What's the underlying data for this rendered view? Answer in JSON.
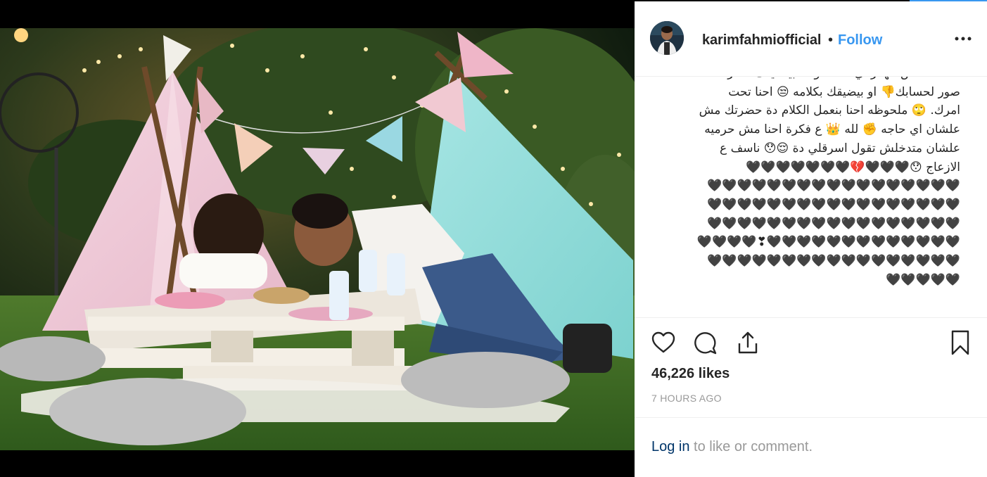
{
  "post": {
    "username": "karimfahmiofficial",
    "separator": "•",
    "follow_label": "Follow",
    "caption_lines": [
      "صفحه تخص الهكر اي.☠ اااكونت بيضايقك ناشر",
      "صور لحسابك👎 او بيضيقك بكلامه 😒 احنا تحت",
      "امرك. 🙄 ملحوظه احنا بنعمل الكلام دة حضرتك مش",
      "علشان اي حاجه ✊ لله 👑 ع فكرة احنا مش حرميه",
      "علشان متدخلش تقول اسرقلي دة 😌😯 ناسف ع",
      "الازعاج 😯🖤🖤🖤💔🖤🖤🖤🖤🖤🖤🖤",
      "🖤🖤🖤🖤🖤🖤🖤🖤🖤🖤🖤🖤🖤🖤🖤🖤🖤",
      "🖤🖤🖤🖤🖤🖤🖤🖤🖤🖤🖤🖤🖤🖤🖤🖤🖤",
      "🖤🖤🖤🖤🖤🖤🖤🖤🖤🖤🖤🖤🖤🖤🖤🖤🖤",
      "🖤🖤🖤🖤🖤🖤🖤🖤🖤🖤🖤🖤🖤❣🖤🖤🖤🖤",
      "🖤🖤🖤🖤🖤🖤🖤🖤🖤🖤🖤🖤🖤🖤🖤🖤🖤",
      "🖤🖤🖤🖤🖤"
    ],
    "likes": "46,226 likes",
    "time_ago": "7 HOURS AGO",
    "login_link": "Log in",
    "login_rest": " to like or comment."
  },
  "icons": {
    "more": "more-options-icon",
    "like": "heart-icon",
    "comment": "comment-icon",
    "share": "share-icon",
    "save": "bookmark-icon"
  },
  "colors": {
    "accent": "#3897f0",
    "text": "#262626",
    "muted": "#999999",
    "link": "#003569"
  }
}
